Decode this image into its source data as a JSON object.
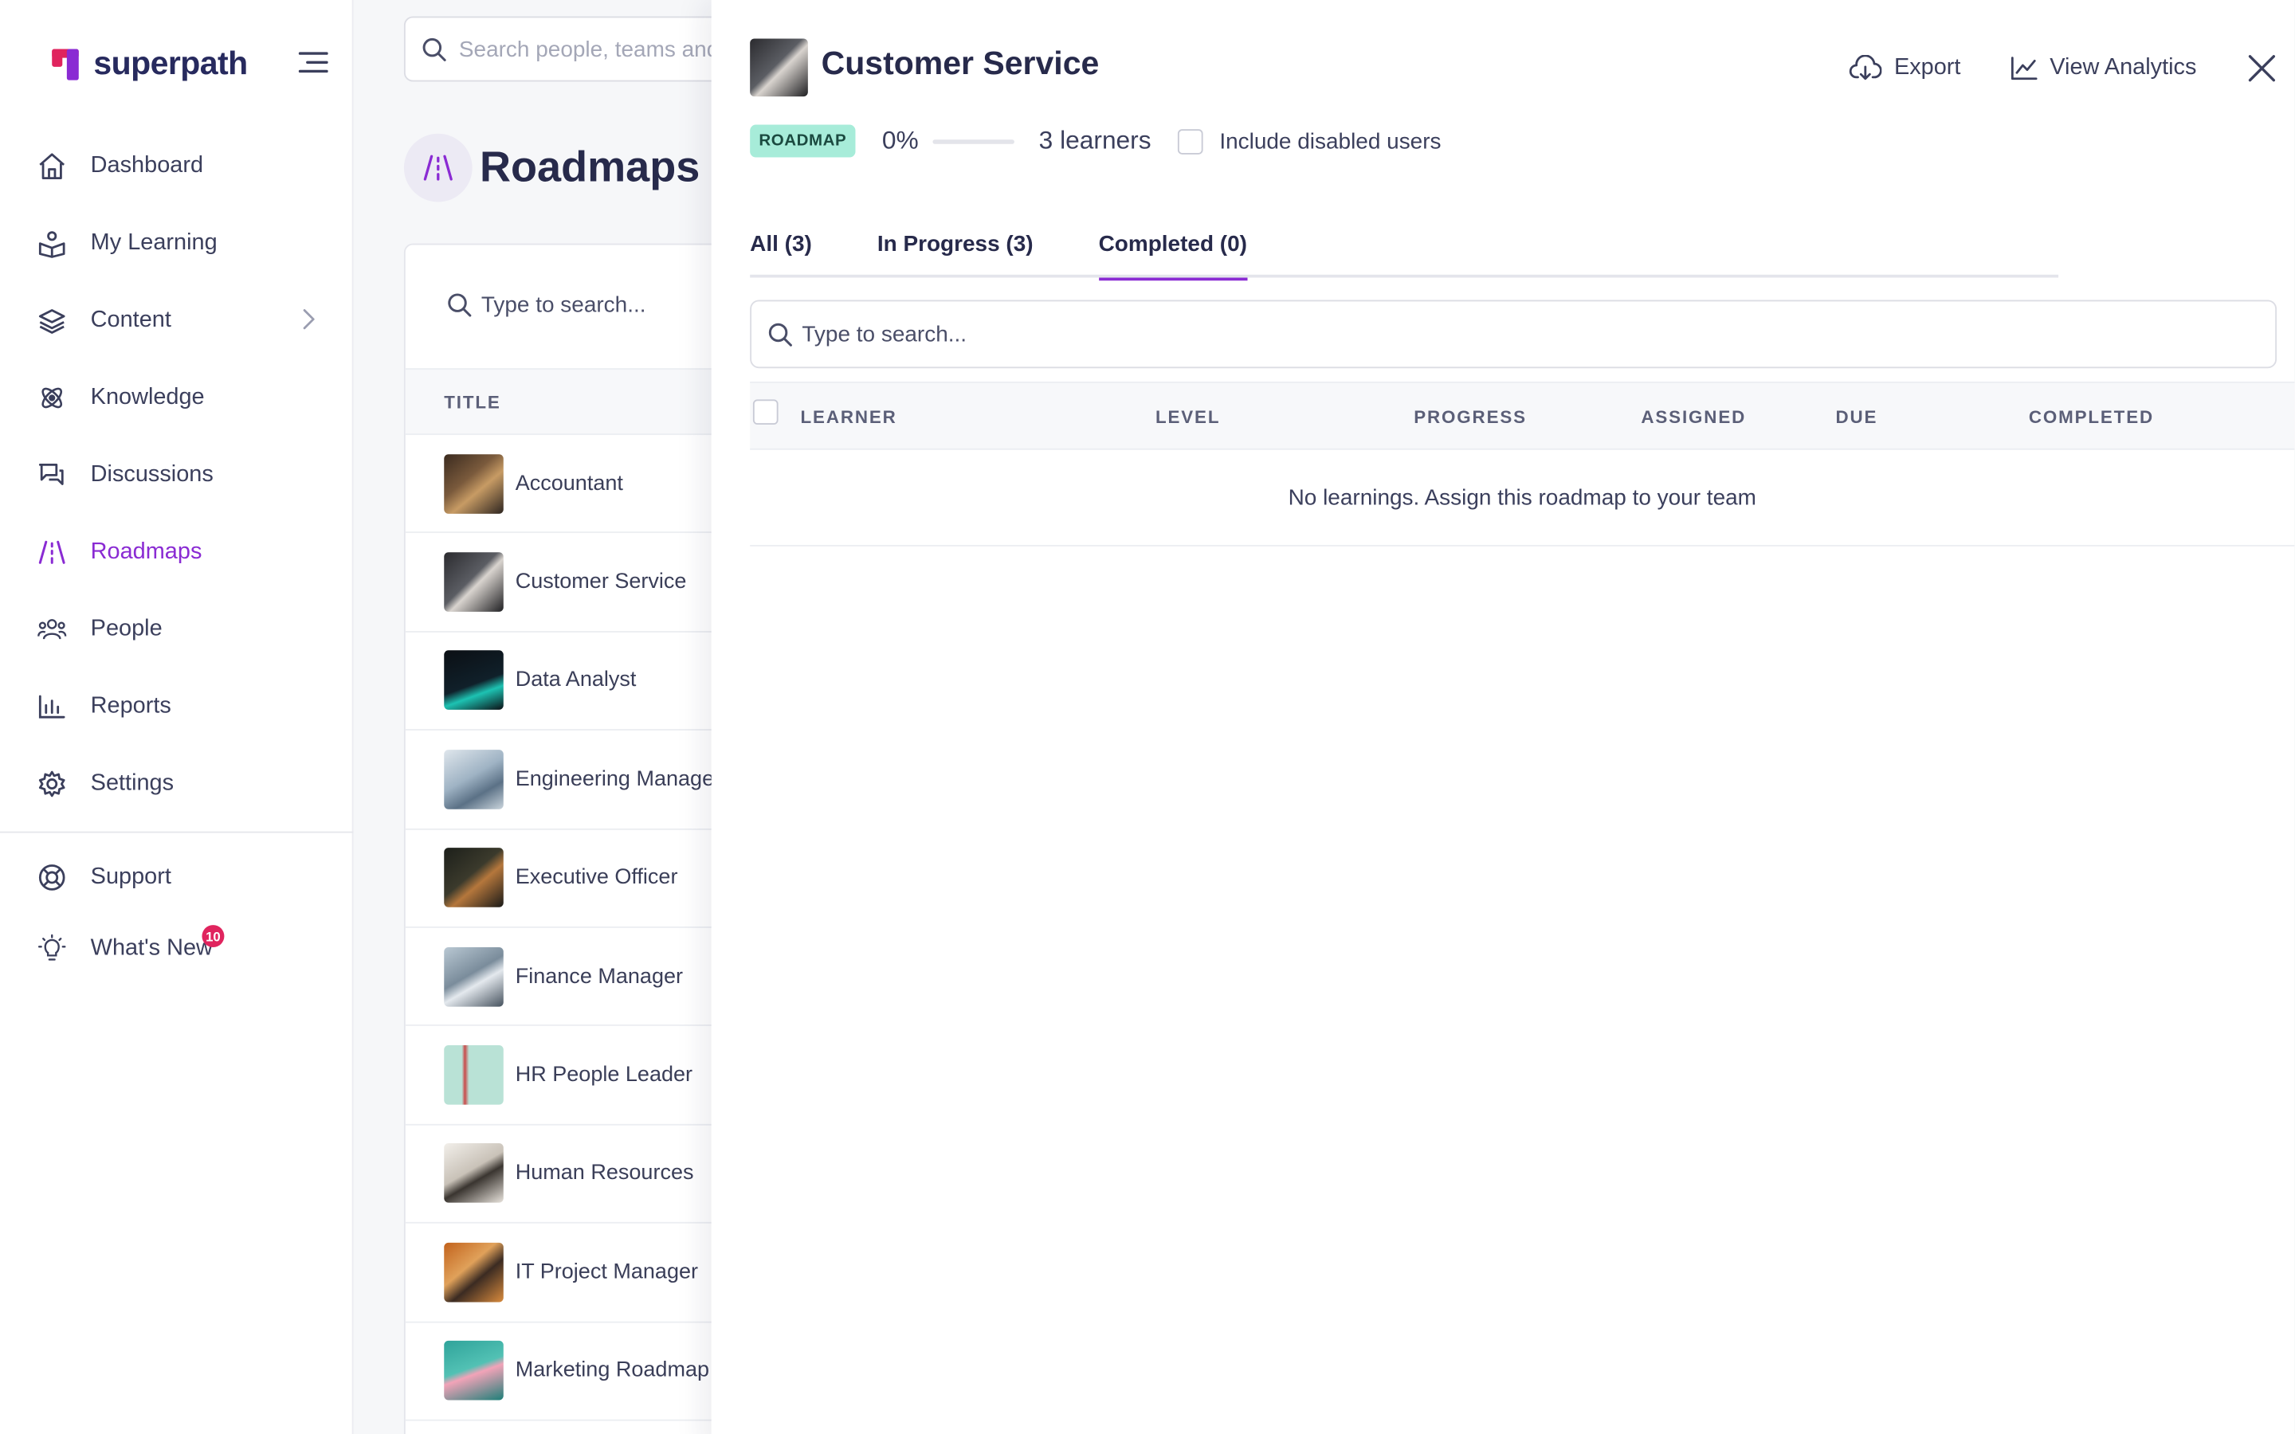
{
  "brand": {
    "name": "superpath",
    "accent": "#8a2bd3",
    "logo_colors": [
      "#e0245e",
      "#8a2bd3"
    ]
  },
  "global_search": {
    "placeholder": "Search people, teams and l"
  },
  "sidebar": {
    "items": [
      {
        "label": "Dashboard",
        "icon": "home-icon"
      },
      {
        "label": "My Learning",
        "icon": "learning-icon"
      },
      {
        "label": "Content",
        "icon": "layers-icon",
        "has_submenu": true
      },
      {
        "label": "Knowledge",
        "icon": "atom-icon"
      },
      {
        "label": "Discussions",
        "icon": "chat-icon"
      },
      {
        "label": "Roadmaps",
        "icon": "road-icon",
        "active": true
      },
      {
        "label": "People",
        "icon": "people-icon"
      },
      {
        "label": "Reports",
        "icon": "bar-chart-icon"
      },
      {
        "label": "Settings",
        "icon": "gear-icon"
      }
    ],
    "bottom_items": [
      {
        "label": "Support",
        "icon": "lifebuoy-icon"
      },
      {
        "label": "What's New",
        "icon": "lightbulb-icon",
        "badge": "10"
      }
    ]
  },
  "page": {
    "title": "Roadmaps",
    "list_search_placeholder": "Type to search...",
    "column_title": "TITLE",
    "roadmaps": [
      "Accountant",
      "Customer Service",
      "Data Analyst",
      "Engineering Manager",
      "Executive Officer",
      "Finance Manager",
      "HR People Leader",
      "Human Resources",
      "IT Project Manager",
      "Marketing Roadmap"
    ]
  },
  "drawer": {
    "title": "Customer Service",
    "actions": {
      "export": "Export",
      "analytics": "View Analytics"
    },
    "tag": "ROADMAP",
    "progress_label": "0%",
    "progress_value": 0,
    "learners": "3 learners",
    "include_disabled_label": "Include disabled users",
    "tabs": [
      {
        "label": "All (3)"
      },
      {
        "label": "In Progress (3)"
      },
      {
        "label": "Completed (0)",
        "active": true
      }
    ],
    "search_placeholder": "Type to search...",
    "columns": [
      "LEARNER",
      "LEVEL",
      "PROGRESS",
      "ASSIGNED",
      "DUE",
      "COMPLETED"
    ],
    "empty_message": "No learnings. Assign this roadmap to your team"
  }
}
